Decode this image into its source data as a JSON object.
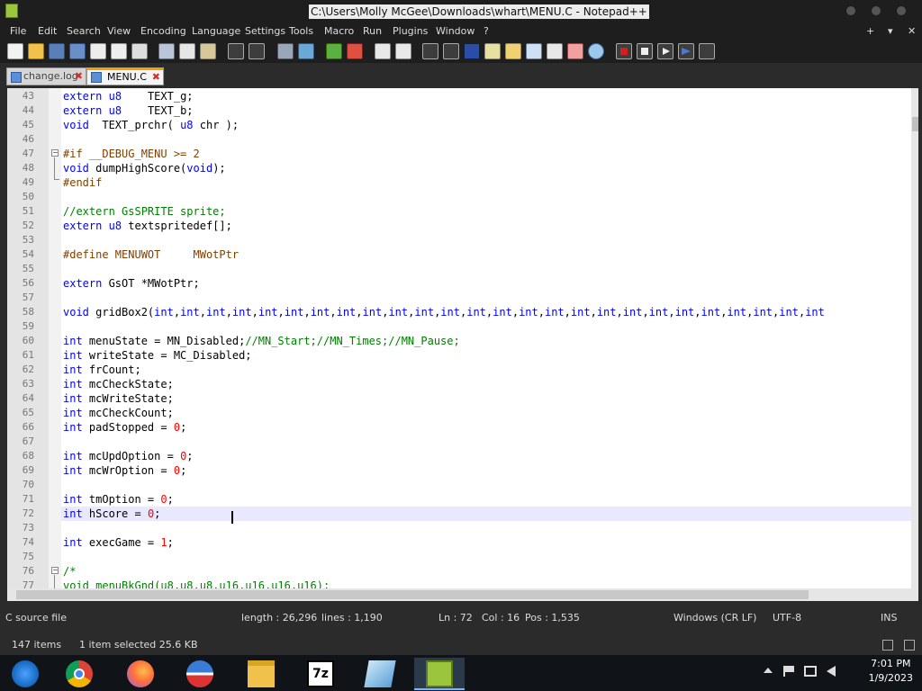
{
  "window": {
    "title": "C:\\Users\\Molly McGee\\Downloads\\whart\\MENU.C - Notepad++"
  },
  "menu": [
    "File",
    "Edit",
    "Search",
    "View",
    "Encoding",
    "Language",
    "Settings",
    "Tools",
    "Macro",
    "Run",
    "Plugins",
    "Window",
    "?"
  ],
  "menu_right": [
    "+",
    "▾",
    "✕"
  ],
  "tabs": [
    {
      "label": "change.log",
      "active": false
    },
    {
      "label": "MENU.C",
      "active": true
    }
  ],
  "code": {
    "line_numbers": [
      "43",
      "44",
      "45",
      "46",
      "47",
      "48",
      "49",
      "50",
      "51",
      "52",
      "53",
      "54",
      "55",
      "56",
      "57",
      "58",
      "59",
      "60",
      "61",
      "62",
      "63",
      "64",
      "65",
      "66",
      "67",
      "68",
      "69",
      "70",
      "71",
      "72",
      "73",
      "74",
      "75",
      "76",
      "77"
    ],
    "lines": [
      "extern u8    TEXT_g;",
      "extern u8    TEXT_b;",
      "void  TEXT_prchr( u8 chr );",
      "",
      "#if __DEBUG_MENU >= 2",
      "void dumpHighScore(void);",
      "#endif",
      "",
      "//extern GsSPRITE sprite;",
      "extern u8 textspritedef[];",
      "",
      "#define MENUWOT     MWotPtr",
      "",
      "extern GsOT *MWotPtr;",
      "",
      "void gridBox2(int,int,int,int,int,int,int,int,int,int,int,int,int,int,int,int,int,int,int,int,int,int,int,int,int,int",
      "",
      "int menuState = MN_Disabled;//MN_Start;//MN_Times;//MN_Pause;",
      "int writeState = MC_Disabled;",
      "int frCount;",
      "int mcCheckState;",
      "int mcWriteState;",
      "int mcCheckCount;",
      "int padStopped = 0;",
      "",
      "int mcUpdOption = 0;",
      "int mcWrOption = 0;",
      "",
      "int tmOption = 0;",
      "int hScore = 0;",
      "",
      "int execGame = 1;",
      "",
      "/*",
      "void menuBkGnd(u8,u8,u8,u16,u16,u16,u16);"
    ]
  },
  "status": {
    "file_type": "C source file",
    "length": "length : 26,296",
    "lines": "lines : 1,190",
    "ln": "Ln : 72",
    "col": "Col : 16",
    "pos": "Pos : 1,535",
    "eol": "Windows (CR LF)",
    "encoding": "UTF-8",
    "mode": "INS"
  },
  "explorer_status": {
    "items": "147 items",
    "selected": "1 item selected  25.6 KB"
  },
  "taskbar": {
    "time": "7:01 PM",
    "date": "1/9/2023"
  },
  "icons": [
    "notepadpp-icon",
    "new-file-icon",
    "open-icon",
    "save-icon",
    "save-all-icon",
    "close-icon",
    "close-all-icon",
    "print-icon",
    "cut-icon",
    "copy-icon",
    "paste-icon",
    "undo-icon",
    "redo-icon",
    "find-icon",
    "replace-icon",
    "zoom-in-icon",
    "zoom-out-icon",
    "sync-v-icon",
    "sync-h-icon",
    "word-wrap-icon",
    "all-chars-icon",
    "indent-guide-icon",
    "user-lang-icon",
    "doc-map-icon",
    "function-list-icon",
    "folder-workspace-icon",
    "monitor-icon",
    "record-macro-icon",
    "stop-macro-icon",
    "play-macro-icon",
    "run-multiple-icon",
    "save-macro-icon"
  ],
  "colors": {
    "keyword": "#0000ff",
    "number": "#ff0000",
    "comment": "#008000",
    "preprocessor": "#804000",
    "current_line": "#e8e8ff",
    "tab_active_accent": "#f4a000"
  }
}
